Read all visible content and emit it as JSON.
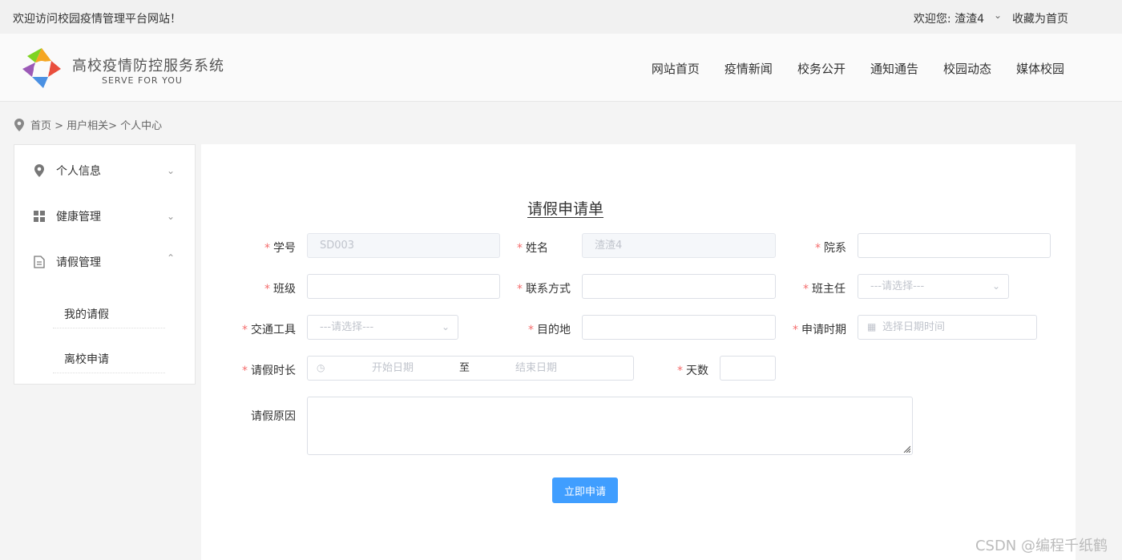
{
  "topbar": {
    "welcome": "欢迎访问校园疫情管理平台网站！",
    "user": "欢迎您: 渣渣4",
    "favorite": "收藏为首页"
  },
  "brand": {
    "title": "高校疫情防控服务系统",
    "subtitle": "SERVE FOR YOU"
  },
  "nav": [
    "网站首页",
    "疫情新闻",
    "校务公开",
    "通知通告",
    "校园动态",
    "媒体校园"
  ],
  "breadcrumb": "首页 > 用户相关> 个人中心",
  "sidebar": {
    "items": [
      {
        "label": "个人信息",
        "icon": "location-icon"
      },
      {
        "label": "健康管理",
        "icon": "grid-icon"
      },
      {
        "label": "请假管理",
        "icon": "document-icon"
      }
    ],
    "subitems": [
      "我的请假",
      "离校申请"
    ]
  },
  "form": {
    "title": "请假申请单",
    "student_id": {
      "label": "学号",
      "value": "SD003"
    },
    "name": {
      "label": "姓名",
      "value": "渣渣4"
    },
    "department": {
      "label": "院系",
      "value": ""
    },
    "class": {
      "label": "班级",
      "value": ""
    },
    "contact": {
      "label": "联系方式",
      "value": ""
    },
    "teacher": {
      "label": "班主任",
      "placeholder": "---请选择---"
    },
    "transport": {
      "label": "交通工具",
      "placeholder": "---请选择---"
    },
    "destination": {
      "label": "目的地",
      "value": ""
    },
    "apply_time": {
      "label": "申请时期",
      "placeholder": "选择日期时间"
    },
    "duration": {
      "label": "请假时长",
      "start_placeholder": "开始日期",
      "separator": "至",
      "end_placeholder": "结束日期"
    },
    "days": {
      "label": "天数",
      "value": ""
    },
    "reason": {
      "label": "请假原因",
      "value": ""
    },
    "submit": "立即申请"
  },
  "watermark": "CSDN @编程千纸鹤",
  "colors": {
    "primary": "#409eff",
    "required": "#f56c6c"
  }
}
